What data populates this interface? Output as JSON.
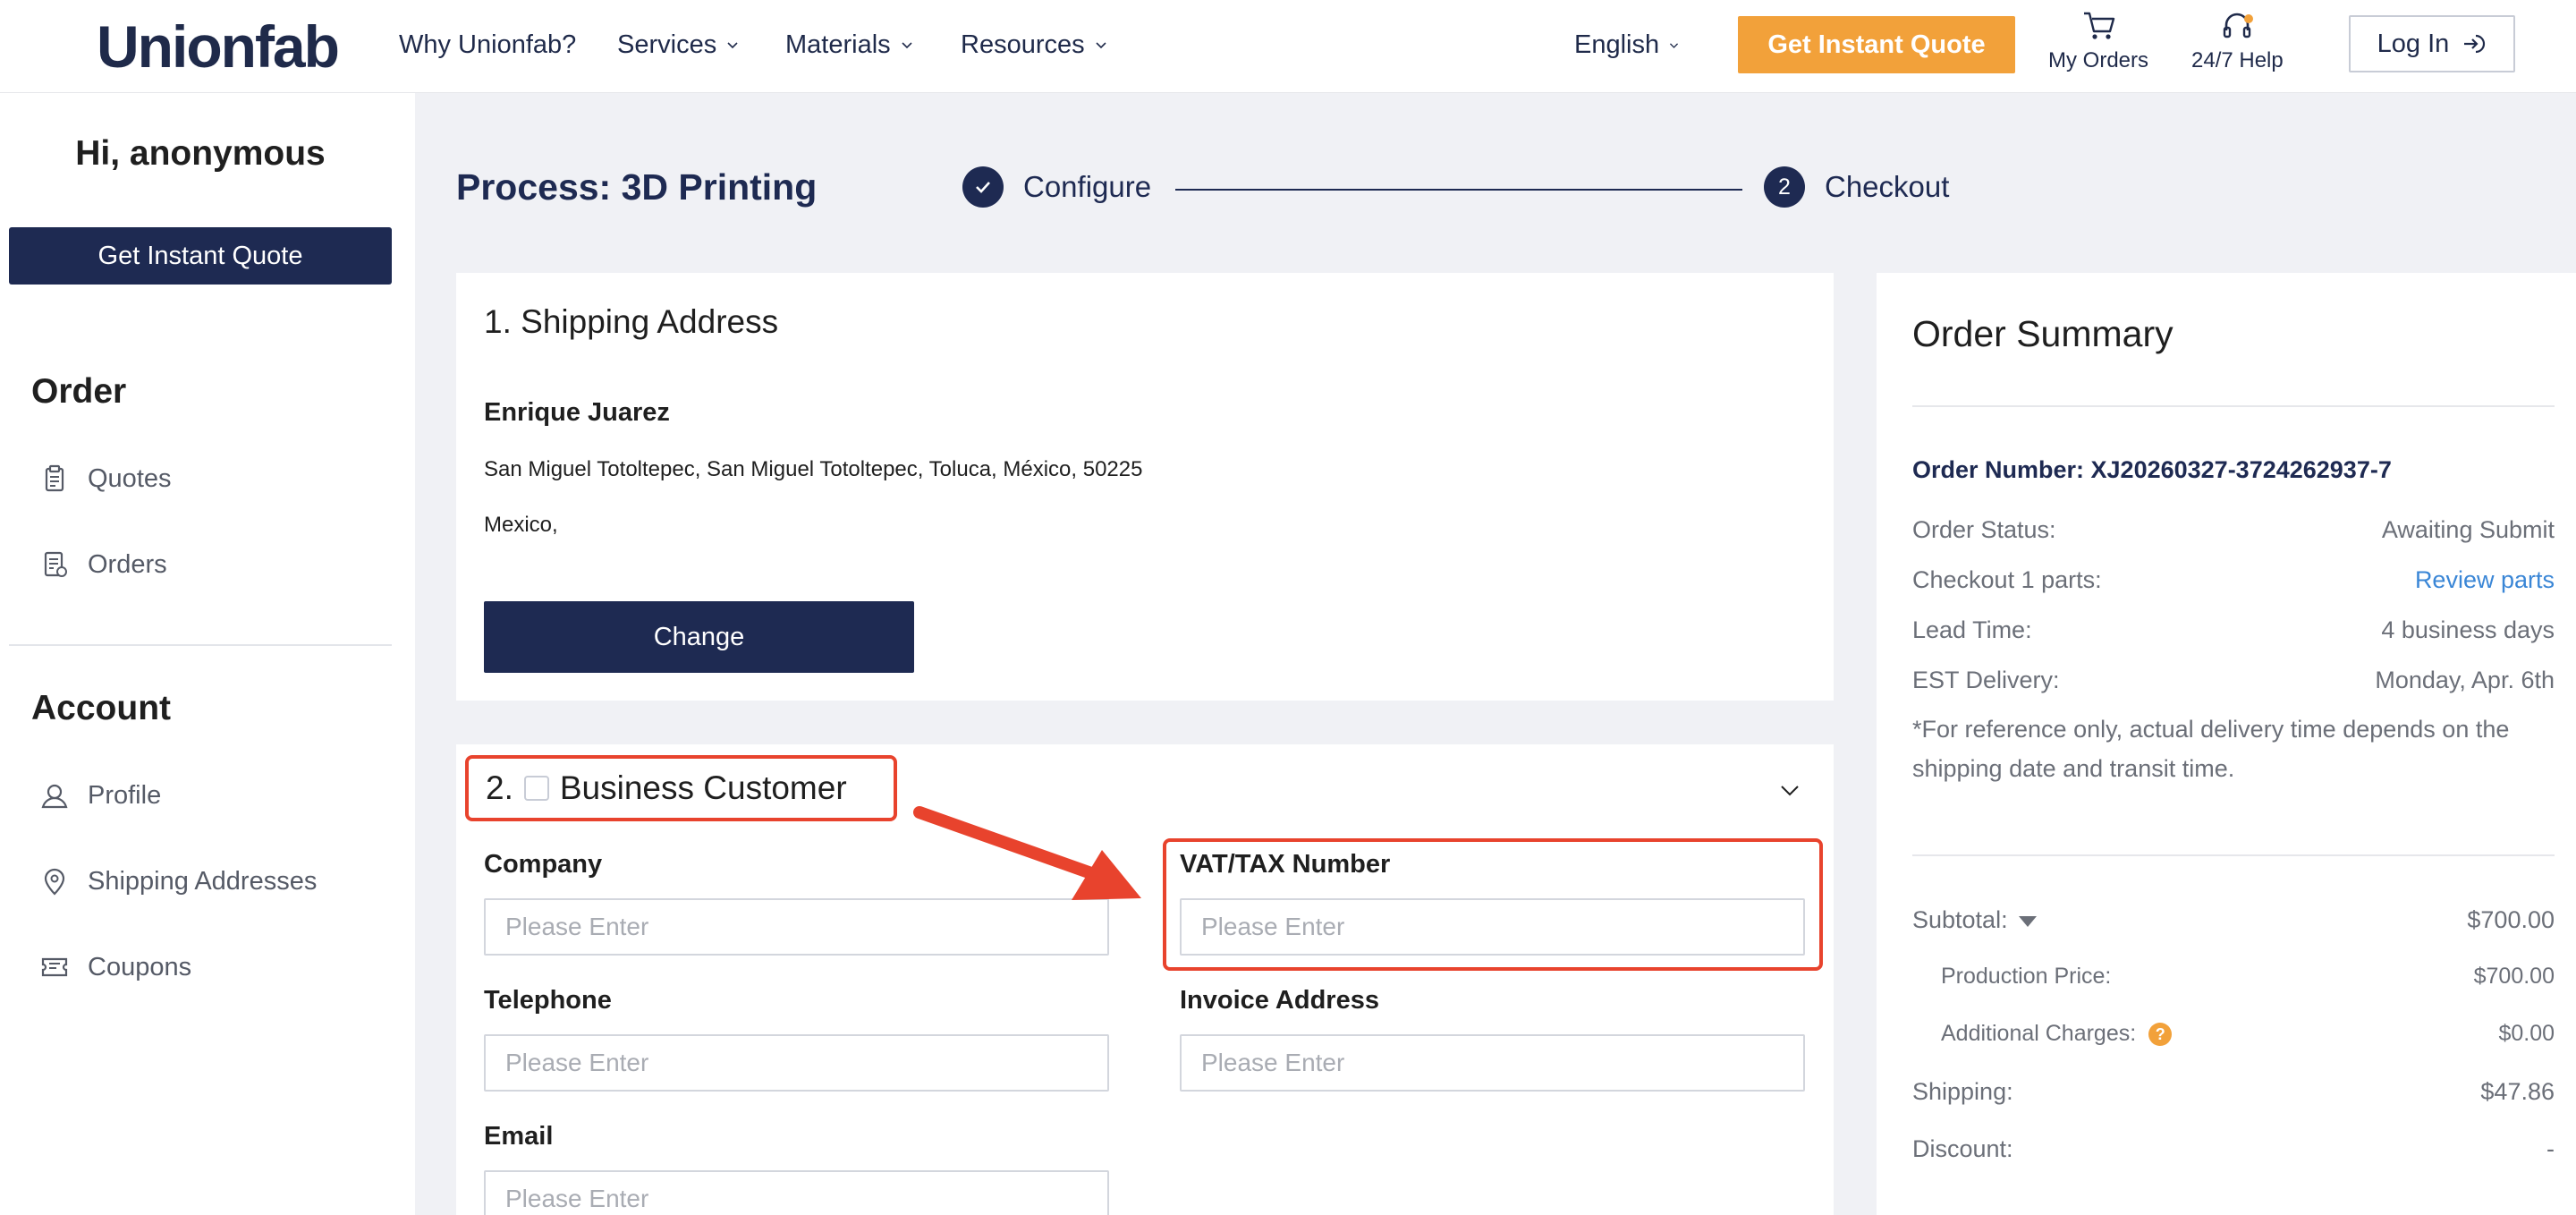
{
  "nav": {
    "logo": "Unionfab",
    "why": "Why Unionfab?",
    "services": "Services",
    "materials": "Materials",
    "resources": "Resources",
    "language": "English",
    "quote_button": "Get Instant Quote",
    "my_orders": "My Orders",
    "help": "24/7 Help",
    "login": "Log In"
  },
  "sidebar": {
    "greeting": "Hi, anonymous",
    "quote_button": "Get Instant Quote",
    "order_section": "Order",
    "order_items": [
      {
        "label": "Quotes",
        "icon": "clipboard-icon"
      },
      {
        "label": "Orders",
        "icon": "order-list-icon"
      }
    ],
    "account_section": "Account",
    "account_items": [
      {
        "label": "Profile",
        "icon": "profile-icon"
      },
      {
        "label": "Shipping Addresses",
        "icon": "location-pin-icon"
      },
      {
        "label": "Coupons",
        "icon": "coupon-icon"
      }
    ]
  },
  "process": {
    "title": "Process: 3D Printing",
    "steps": [
      {
        "label": "Configure",
        "state": "done"
      },
      {
        "label": "Checkout",
        "number": "2",
        "state": "current"
      }
    ]
  },
  "shipping": {
    "title": "1. Shipping Address",
    "name": "Enrique Juarez",
    "address_line": "San Miguel Totoltepec, San Miguel Totoltepec, Toluca, México, 50225",
    "country_line": "Mexico,",
    "change_button": "Change"
  },
  "business": {
    "number": "2.",
    "title": "Business Customer",
    "checked": false,
    "fields": {
      "company": {
        "label": "Company",
        "placeholder": "Please Enter",
        "value": ""
      },
      "vat": {
        "label": "VAT/TAX Number",
        "placeholder": "Please Enter",
        "value": ""
      },
      "telephone": {
        "label": "Telephone",
        "placeholder": "Please Enter",
        "value": ""
      },
      "invoice_address": {
        "label": "Invoice Address",
        "placeholder": "Please Enter",
        "value": ""
      },
      "email": {
        "label": "Email",
        "placeholder": "Please Enter",
        "value": ""
      }
    }
  },
  "summary": {
    "title": "Order Summary",
    "order_number": "Order Number: XJ20260327-3724262937-7",
    "status_label": "Order Status:",
    "status_value": "Awaiting Submit",
    "checkout_label": "Checkout 1 parts:",
    "checkout_link": "Review parts",
    "lead_label": "Lead Time:",
    "lead_value": "4 business days",
    "delivery_label": "EST Delivery:",
    "delivery_value": "Monday, Apr. 6th",
    "note": "*For reference only, actual delivery time depends on the shipping date and transit time.",
    "subtotal_label": "Subtotal:",
    "subtotal_value": "$700.00",
    "production_label": "Production Price:",
    "production_value": "$700.00",
    "additional_label": "Additional Charges:",
    "additional_value": "$0.00",
    "shipping_label": "Shipping:",
    "shipping_value": "$47.86",
    "discount_label": "Discount:",
    "discount_value": "-"
  },
  "colors": {
    "navy": "#1e2a52",
    "orange": "#f2a13a",
    "annotation_red": "#e8432d",
    "link_blue": "#3a86d6"
  }
}
